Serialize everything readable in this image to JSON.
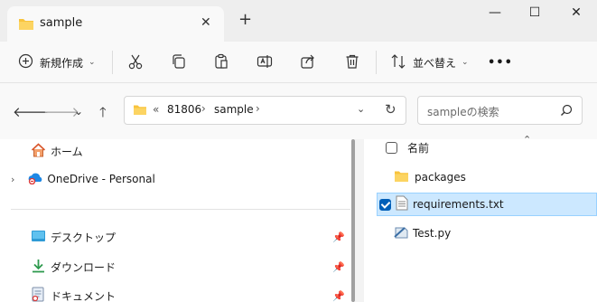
{
  "window": {
    "tab_title": "sample",
    "tab_close": "✕",
    "new_tab": "+",
    "minimize": "—",
    "maximize": "☐",
    "close": "✕"
  },
  "toolbar": {
    "new_label": "新規作成",
    "sort_label": "並べ替え",
    "more": "•••",
    "icons": [
      "scissors-icon",
      "copy-icon",
      "paste-icon",
      "rename-icon",
      "share-icon",
      "delete-icon",
      "sort-icon"
    ]
  },
  "address": {
    "overflow": "«",
    "crumbs": [
      "81806",
      "sample"
    ],
    "separator": "›",
    "search_placeholder": "sampleの検索"
  },
  "nav": {
    "items": [
      {
        "label": "ホーム",
        "icon": "home-icon",
        "pinned": false
      },
      {
        "label": "OneDrive - Personal",
        "icon": "onedrive-icon",
        "pinned": false
      },
      {
        "label": "デスクトップ",
        "icon": "desktop-icon",
        "pinned": true
      },
      {
        "label": "ダウンロード",
        "icon": "download-icon",
        "pinned": true
      },
      {
        "label": "ドキュメント",
        "icon": "documents-icon",
        "pinned": true
      }
    ]
  },
  "files": {
    "header": "名前",
    "items": [
      {
        "name": "packages",
        "type": "folder",
        "selected": false
      },
      {
        "name": "requirements.txt",
        "type": "text",
        "selected": true
      },
      {
        "name": "Test.py",
        "type": "python",
        "selected": false
      }
    ]
  },
  "colors": {
    "accent": "#005fb8",
    "selection": "#cce8ff",
    "folder": "#f8c33c"
  }
}
